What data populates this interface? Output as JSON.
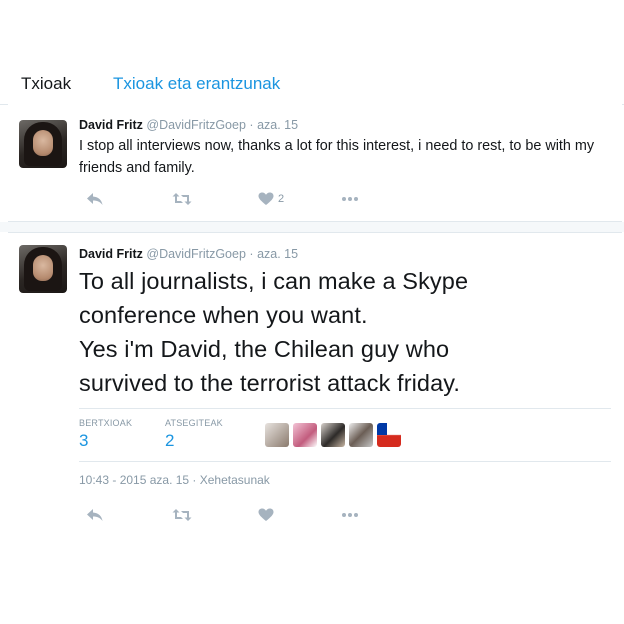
{
  "tabs": {
    "tweets": "Txioak",
    "tweets_replies": "Txioak eta erantzunak"
  },
  "tweet1": {
    "fullname": "David Fritz",
    "handle": "@DavidFritzGoep",
    "dot": "·",
    "date": "aza. 15",
    "text": "I stop all interviews now, thanks a lot for this interest, i need to rest, to be with my friends and family.",
    "like_count": "2",
    "icons": [
      "reply-icon",
      "retweet-icon",
      "heart-icon",
      "more-icon"
    ]
  },
  "tweet2": {
    "fullname": "David Fritz",
    "handle": "@DavidFritzGoep",
    "dot": "·",
    "date": "aza. 15",
    "text_line1": "To all journalists, i can make a Skype",
    "text_line2": "conference when you want.",
    "text_line3": "Yes i'm David, the Chilean guy who",
    "text_line4": "survived to the terrorist attack friday.",
    "retweets_label": "BERTXIOAK",
    "retweets_value": "3",
    "likes_label": "ATSEGITEAK",
    "likes_value": "2",
    "timestamp": "10:43 - 2015 aza. 15 · Xehetasunak",
    "icons": [
      "reply-icon",
      "retweet-icon",
      "heart-icon",
      "more-icon"
    ]
  },
  "colors": {
    "accent": "#1b95e0",
    "muted": "#8899a6",
    "icon": "#a6b3bf",
    "text": "#14171a",
    "border": "#e1e8ed"
  }
}
